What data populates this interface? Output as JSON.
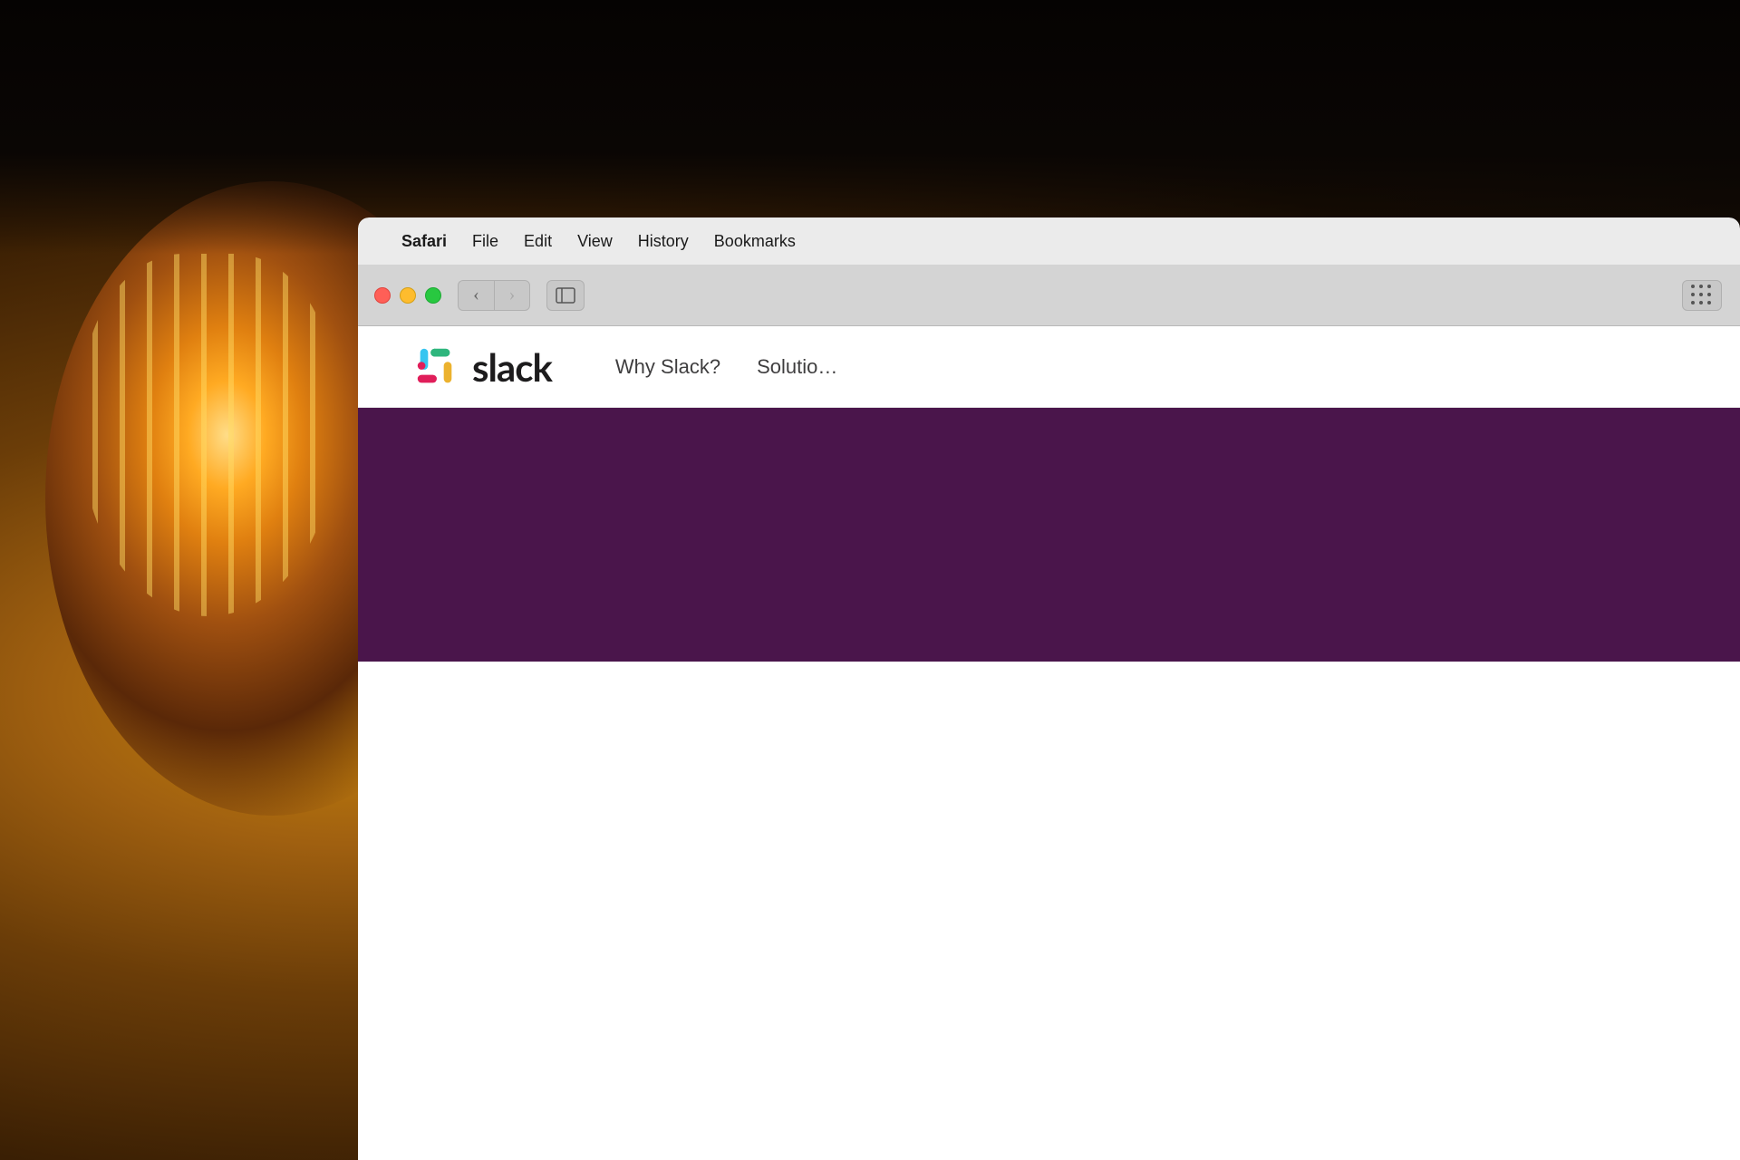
{
  "background": {
    "description": "Dark moody photography background with warm Edison bulb light"
  },
  "macos_menubar": {
    "apple_symbol": "",
    "items": [
      {
        "label": "Safari",
        "bold": true
      },
      {
        "label": "File",
        "bold": false
      },
      {
        "label": "Edit",
        "bold": false
      },
      {
        "label": "View",
        "bold": false
      },
      {
        "label": "History",
        "bold": false
      },
      {
        "label": "Bookmarks",
        "bold": false
      }
    ]
  },
  "browser_toolbar": {
    "back_label": "‹",
    "forward_label": "›",
    "sidebar_icon": "□"
  },
  "slack_page": {
    "logo_text": "slack",
    "nav_links": [
      {
        "label": "Why Slack?"
      },
      {
        "label": "Solutio…"
      }
    ],
    "hero_color": "#4a154b",
    "navbar_bg": "#ffffff"
  }
}
